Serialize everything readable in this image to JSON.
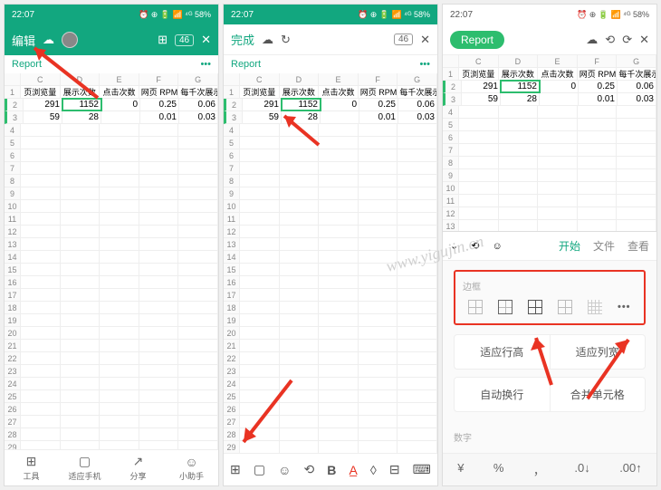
{
  "status": {
    "time": "22:07",
    "icons": "⏰ ⊕ 🔋 📶 ⁴ᴳ 58%"
  },
  "screen1": {
    "toolbar": {
      "edit": "编辑",
      "grid_badge": "46"
    },
    "report": "Report",
    "cols": [
      "C",
      "D",
      "E",
      "F",
      "G"
    ],
    "headers": [
      "页浏览量",
      "展示次数",
      "点击次数",
      "网页 RPM",
      "每千次展示"
    ],
    "rows": [
      {
        "n": "2",
        "cells": [
          "291",
          "1152",
          "0",
          "0.25",
          "0.06"
        ]
      },
      {
        "n": "3",
        "cells": [
          "59",
          "28",
          "",
          "0.01",
          "0.03"
        ]
      }
    ],
    "bottom": [
      {
        "icon": "⊞",
        "label": "工具"
      },
      {
        "icon": "▢",
        "label": "适应手机"
      },
      {
        "icon": "↗",
        "label": "分享"
      },
      {
        "icon": "☺",
        "label": "小助手"
      }
    ]
  },
  "screen2": {
    "toolbar": {
      "done": "完成",
      "badge": "46"
    },
    "editbar_icons": [
      "⊞",
      "▢",
      "☺",
      "⟲",
      "B",
      "A̲",
      "◊",
      "⊟",
      "⌨"
    ]
  },
  "screen3": {
    "toolbar": {
      "report": "Report"
    },
    "cols": [
      "C",
      "D",
      "E",
      "F",
      "G"
    ],
    "headers": [
      "页浏览量",
      "展示次数",
      "点击次数",
      "网页 RPM",
      "每千次展示"
    ],
    "rows": [
      {
        "n": "2",
        "cells": [
          "291",
          "1152",
          "0",
          "0.25",
          "0.06"
        ]
      },
      {
        "n": "3",
        "cells": [
          "59",
          "28",
          "",
          "0.01",
          "0.03"
        ]
      }
    ],
    "panel": {
      "collapse": "⌄",
      "undo": "⟲",
      "emoji": "☺",
      "tabs": [
        "开始",
        "文件",
        "查看"
      ],
      "section_border": "边框",
      "more": "•••",
      "fit_row": "适应行高",
      "fit_col": "适应列宽",
      "wrap": "自动换行",
      "merge": "合并单元格",
      "section_number": "数字",
      "numfmt": [
        "¥",
        "%",
        "，",
        ".0↓",
        ".00↑"
      ]
    }
  },
  "watermark": "www.yigujin.cn"
}
